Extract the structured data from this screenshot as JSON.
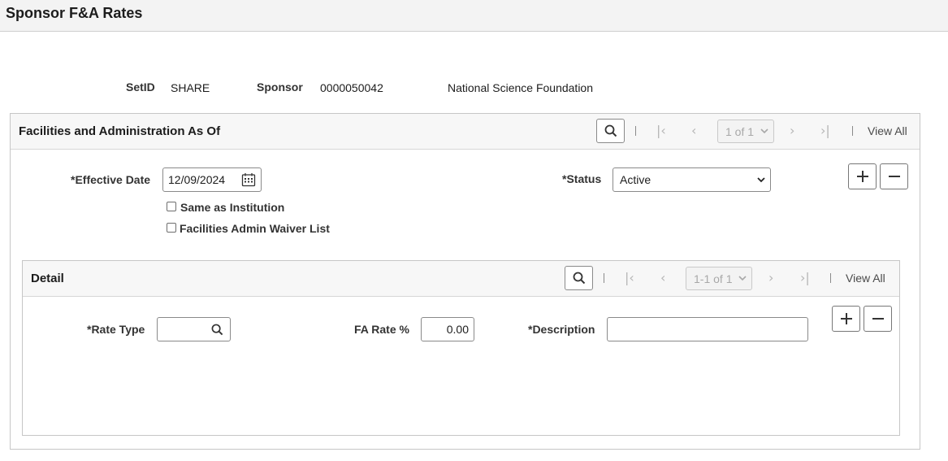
{
  "page": {
    "title": "Sponsor F&A Rates"
  },
  "key_fields": {
    "setid_label": "SetID",
    "setid_value": "SHARE",
    "sponsor_label": "Sponsor",
    "sponsor_value": "0000050042",
    "sponsor_name": "National Science Foundation"
  },
  "fa_group": {
    "title": "Facilities and Administration As Of",
    "pager": "1 of 1",
    "view_all": "View All",
    "effective_date_label": "*Effective Date",
    "effective_date_value": "12/09/2024",
    "status_label": "*Status",
    "status_value": "Active",
    "same_as_institution_label": "Same as Institution",
    "waiver_list_label": "Facilities Admin Waiver List"
  },
  "detail_group": {
    "title": "Detail",
    "pager": "1-1 of 1",
    "view_all": "View All",
    "rate_type_label": "*Rate Type",
    "rate_type_value": "",
    "fa_rate_label": "FA Rate %",
    "fa_rate_value": "0.00",
    "description_label": "*Description",
    "description_value": ""
  },
  "icons": {
    "search": "search-icon",
    "first": "first-page-icon",
    "previous": "previous-icon",
    "next": "next-icon",
    "last": "last-page-icon",
    "add": "plus-icon",
    "delete": "minus-icon",
    "calendar": "calendar-icon",
    "dropdown": "chevron-down-icon"
  },
  "colors": {
    "header_bg": "#f3f3f3",
    "group_head_bg": "#f7f7f7",
    "border": "#c6c6c6",
    "disabled_text": "#b6b6b6"
  }
}
